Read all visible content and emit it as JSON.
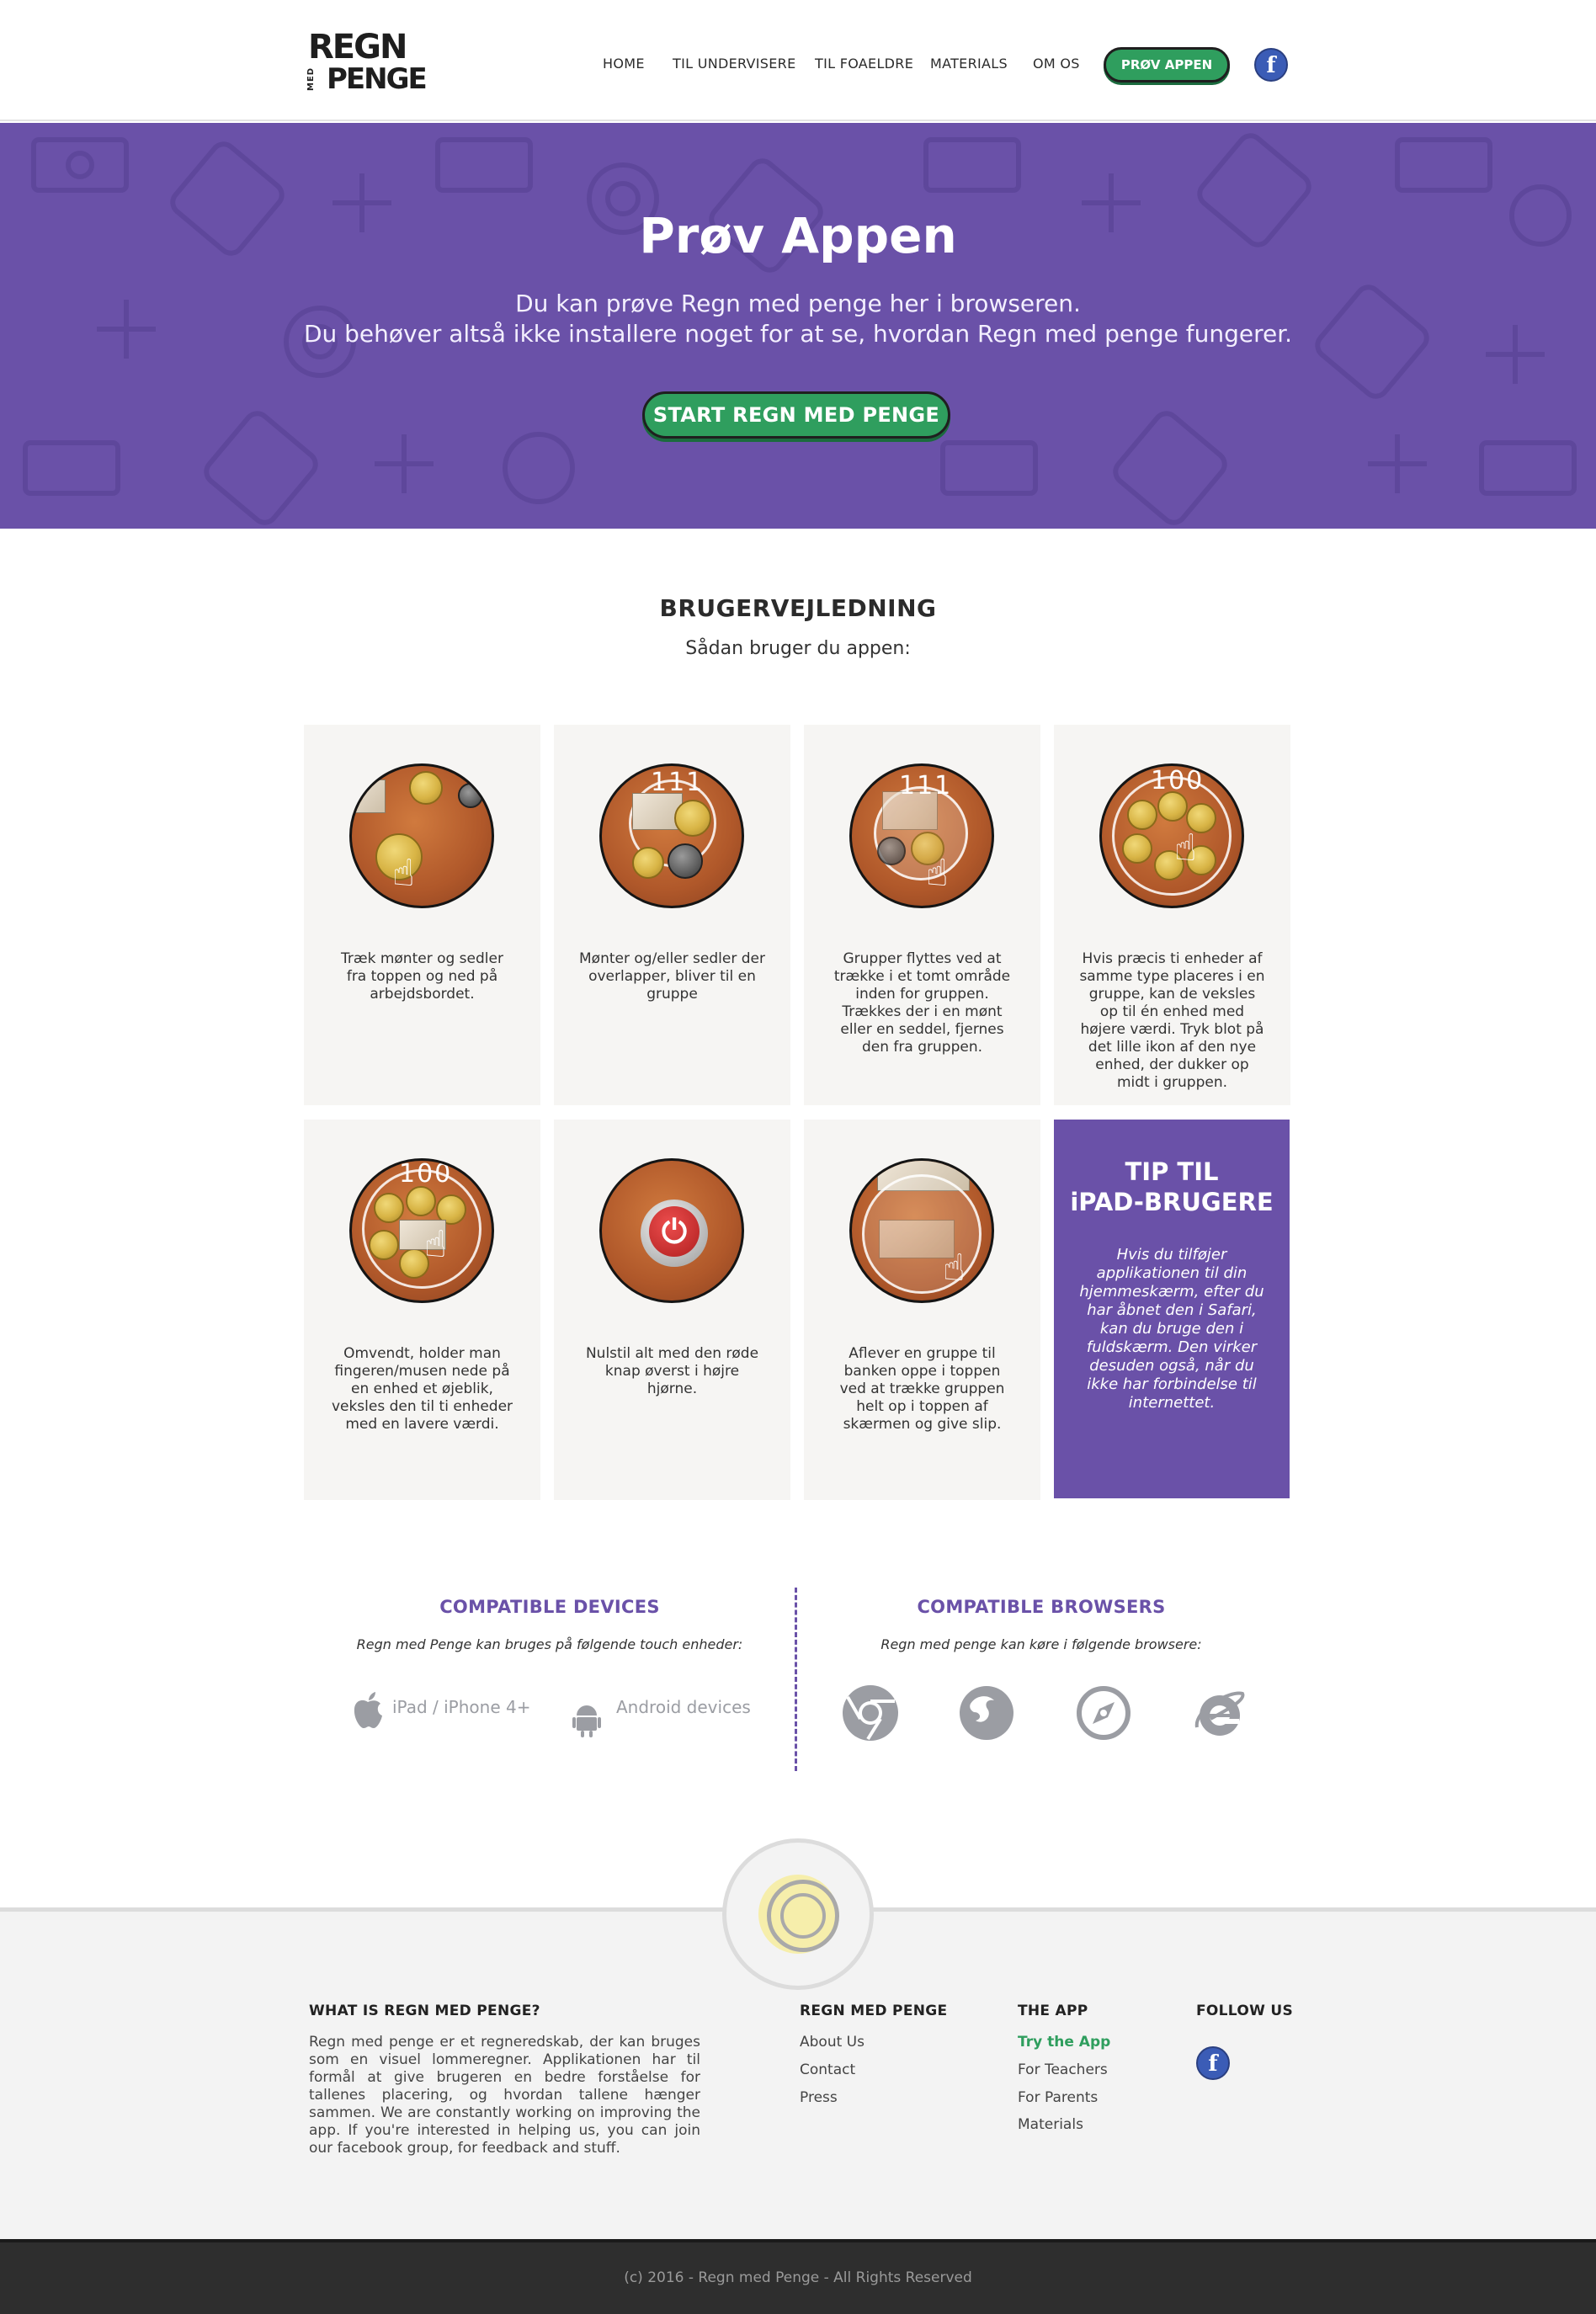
{
  "colors": {
    "brand_purple": "#6a51a8",
    "brand_green": "#2f9e5e",
    "facebook_blue": "#3b5cb6",
    "footer_dark": "#2e2e2e"
  },
  "header": {
    "logo_top": "REGN",
    "logo_med": "MED",
    "logo_bottom": "PENGE",
    "nav": [
      "HOME",
      "TIL UNDERVISERE",
      "TIL FOAELDRE",
      "MATERIALS",
      "OM OS"
    ],
    "cta_label": "PRØV APPEN",
    "social_icon": "facebook-icon",
    "social_glyph": "f"
  },
  "hero": {
    "title": "Prøv Appen",
    "line1": "Du kan prøve Regn med penge her i browseren.",
    "line2": "Du behøver altså ikke installere noget for at se, hvordan Regn med penge fungerer.",
    "button_label": "START REGN MED PENGE"
  },
  "guide": {
    "title": "BRUGERVEJLEDNING",
    "subtitle": "Sådan bruger du appen:",
    "steps": [
      {
        "text": "Træk mønter og sedler fra toppen og ned på arbejdsbordet."
      },
      {
        "text": "Mønter og/eller sedler der overlapper, bliver til en gruppe",
        "number": "111"
      },
      {
        "text": "Grupper flyttes ved at trække i et tomt område inden for gruppen. Trækkes der i en mønt eller en seddel, fjernes den fra gruppen.",
        "number": "111"
      },
      {
        "text": "Hvis præcis ti enheder af samme type placeres i en gruppe, kan de veksles op til én enhed med højere værdi. Tryk blot på det lille ikon af den nye enhed, der dukker op midt i gruppen.",
        "number": "100"
      },
      {
        "text": "Omvendt, holder man fingeren/musen nede på en enhed et øjeblik, veksles den til ti enheder med en lavere værdi.",
        "number": "100"
      },
      {
        "text": "Nulstil alt med den røde knap øverst i højre hjørne."
      },
      {
        "text": "Aflever en gruppe til banken oppe i toppen ved at trække gruppen helt op i toppen af skærmen og give slip."
      }
    ],
    "tip": {
      "title_line1": "TIP TIL",
      "title_line2": "iPAD-BRUGERE",
      "text": "Hvis du tilføjer applikationen til din hjemmeskærm, efter du har åbnet den i Safari, kan du bruge den i fuldskærm. Den virker desuden også, når du ikke har forbindelse til internettet."
    }
  },
  "compat": {
    "devices_title": "COMPATIBLE DEVICES",
    "devices_sub": "Regn med Penge kan bruges på følgende touch enheder:",
    "devices": [
      {
        "label": "iPad / iPhone 4+",
        "icon": "apple-icon"
      },
      {
        "label": "Android devices",
        "icon": "android-icon"
      }
    ],
    "browsers_title": "COMPATIBLE BROWSERS",
    "browsers_sub": "Regn med penge kan køre i følgende browsere:",
    "browsers": [
      "chrome-icon",
      "firefox-icon",
      "safari-icon",
      "ie-icon"
    ]
  },
  "footer": {
    "about_title": "WHAT IS REGN MED PENGE?",
    "about_text": "Regn med penge er et regneredskab, der kan bruges som en visuel lommeregner. Applikationen har til formål at give brugeren en bedre forståelse for tallenes placering, og hvordan tallene hænger sammen. We are constantly working on improving the app. If you're interested in helping us, you can join our facebook group, for feedback and stuff.",
    "col1_title": "REGN MED PENGE",
    "col1_links": [
      "About Us",
      "Contact",
      "Press"
    ],
    "col2_title": "THE APP",
    "col2_links": [
      "Try the App",
      "For Teachers",
      "For Parents",
      "Materials"
    ],
    "col3_title": "FOLLOW US",
    "copyright": "(c)  2016 - Regn med Penge  - All Rights Reserved"
  }
}
